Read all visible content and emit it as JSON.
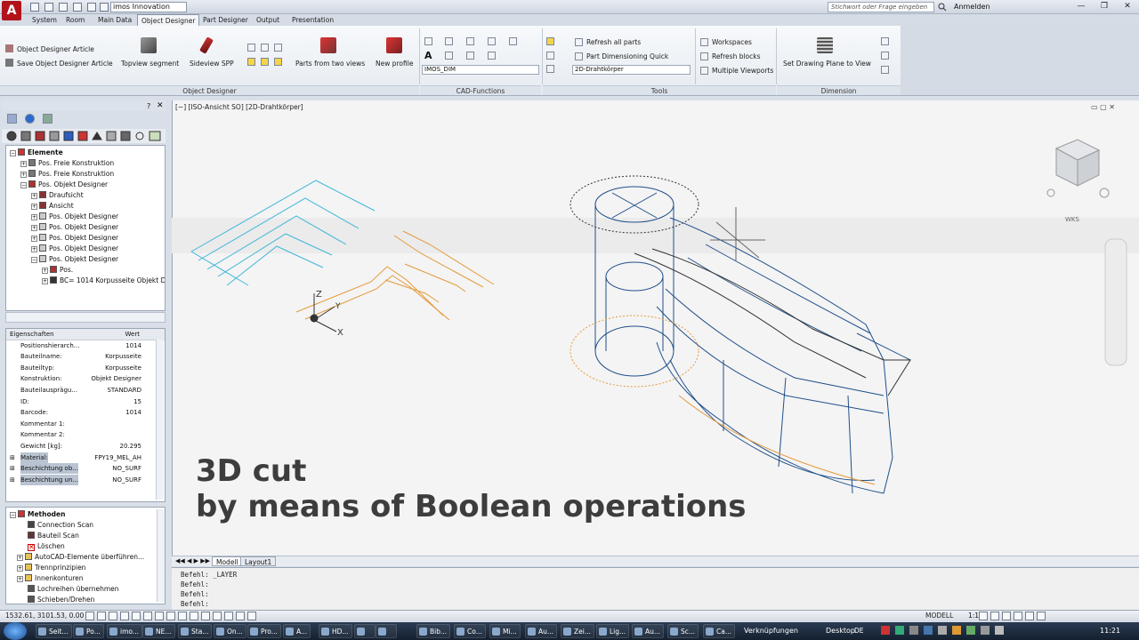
{
  "titlebar": {
    "doc_title": "imos Innovation",
    "search_placeholder": "Stichwort oder Frage eingeben",
    "login": "Anmelden"
  },
  "ribbon_tabs": [
    "System",
    "Room",
    "Main Data",
    "Object Designer",
    "Part Designer",
    "Output",
    "Presentation"
  ],
  "ribbon": {
    "object_designer_article": "Object Designer Article",
    "save_object_designer_article": "Save Object Designer Article",
    "topview_segment": "Topview segment",
    "sideview_spp": "Sideview SPP",
    "parts_from_two_views": "Parts from two views",
    "new_profile": "New profile",
    "imos_dim_combo": "IMOS_DIM",
    "refresh_all_parts": "Refresh all parts",
    "part_dimensioning_quick": "Part Dimensioning Quick",
    "visual_style_combo": "2D-Drahtkörper",
    "workspaces": "Workspaces",
    "refresh_blocks": "Refresh blocks",
    "multiple_viewports": "Multiple Viewports",
    "set_drawing_plane": "Set Drawing Plane to View",
    "panel_labels": {
      "object_designer": "Object Designer",
      "cad_functions": "CAD-Functions",
      "tools": "Tools",
      "dimension": "Dimension"
    }
  },
  "tree": {
    "rows": [
      {
        "label": "Elemente",
        "bold": true
      },
      {
        "label": "Pos.   Freie Konstruktion"
      },
      {
        "label": "Pos.   Freie Konstruktion"
      },
      {
        "label": "Pos.   Objekt Designer"
      },
      {
        "label": "Draufsicht"
      },
      {
        "label": "Ansicht"
      },
      {
        "label": "Pos.   Objekt Designer"
      },
      {
        "label": "Pos.   Objekt Designer"
      },
      {
        "label": "Pos.   Objekt Designer"
      },
      {
        "label": "Pos.   Objekt Designer"
      },
      {
        "label": "Pos.   Objekt Designer"
      },
      {
        "label": "Pos."
      },
      {
        "label": "BC= 1014 Korpusseite Objekt De"
      }
    ]
  },
  "properties": {
    "header_key": "Eigenschaften",
    "header_val": "Wert",
    "rows": [
      {
        "key": "Positionshierarch...",
        "val": "1014"
      },
      {
        "key": "Bauteilname:",
        "val": "Korpusseite"
      },
      {
        "key": "Bauteiltyp:",
        "val": "Korpusseite"
      },
      {
        "key": "Konstruktion:",
        "val": "Objekt Designer"
      },
      {
        "key": "Bauteilausprägu...",
        "val": "STANDARD"
      },
      {
        "key": "ID:",
        "val": "15"
      },
      {
        "key": "Barcode:",
        "val": "1014"
      },
      {
        "key": "Kommentar 1:",
        "val": ""
      },
      {
        "key": "Kommentar 2:",
        "val": ""
      },
      {
        "key": "Gewicht [kg]:",
        "val": "20.295"
      },
      {
        "key": "Material:",
        "val": "FPY19_MEL_AH"
      },
      {
        "key": "Beschichtung ob...",
        "val": "NO_SURF"
      },
      {
        "key": "Beschichtung un...",
        "val": "NO_SURF"
      }
    ]
  },
  "methods": {
    "rows": [
      {
        "label": "Methoden",
        "bold": true
      },
      {
        "label": "Connection Scan"
      },
      {
        "label": "Bauteil Scan"
      },
      {
        "label": "Löschen"
      },
      {
        "label": "AutoCAD-Elemente überführen..."
      },
      {
        "label": "Trennprinzipien"
      },
      {
        "label": "Innenkonturen"
      },
      {
        "label": "Lochreihen übernehmen"
      },
      {
        "label": "Schieben/Drehen"
      }
    ]
  },
  "viewport": {
    "label": "[−] [ISO-Ansicht SO] [2D-Drahtkörper]",
    "wcs": "WKS",
    "caption_line1": "3D cut",
    "caption_line2": "by means of Boolean operations"
  },
  "layout_tabs": [
    "Modell",
    "Layout1"
  ],
  "command_lines": [
    "Befehl: _LAYER",
    "Befehl:",
    "Befehl:",
    "Befehl:"
  ],
  "status": {
    "coords": "1532.61, 3101.53, 0.00",
    "model": "MODELL",
    "scale": "1:1"
  },
  "taskbar": {
    "tasks": [
      "Seit...",
      "Po...",
      "imo...",
      "NE...",
      "Sta...",
      "On...",
      "Pro...",
      "A...",
      "HD...",
      "",
      "",
      "Bib...",
      "Co...",
      "Mi...",
      "Au...",
      "Zei...",
      "Lig...",
      "Au...",
      "Sc...",
      "Ca..."
    ],
    "tray_text": "Verknüpfungen",
    "desktop": "Desktop",
    "lang": "DE",
    "clock": "11:21"
  },
  "colors": {
    "accent_red": "#b2131b",
    "wire_blue": "#1f4f8a",
    "wire_cyan": "#3fb6d8",
    "wire_orange": "#e49a3a"
  }
}
